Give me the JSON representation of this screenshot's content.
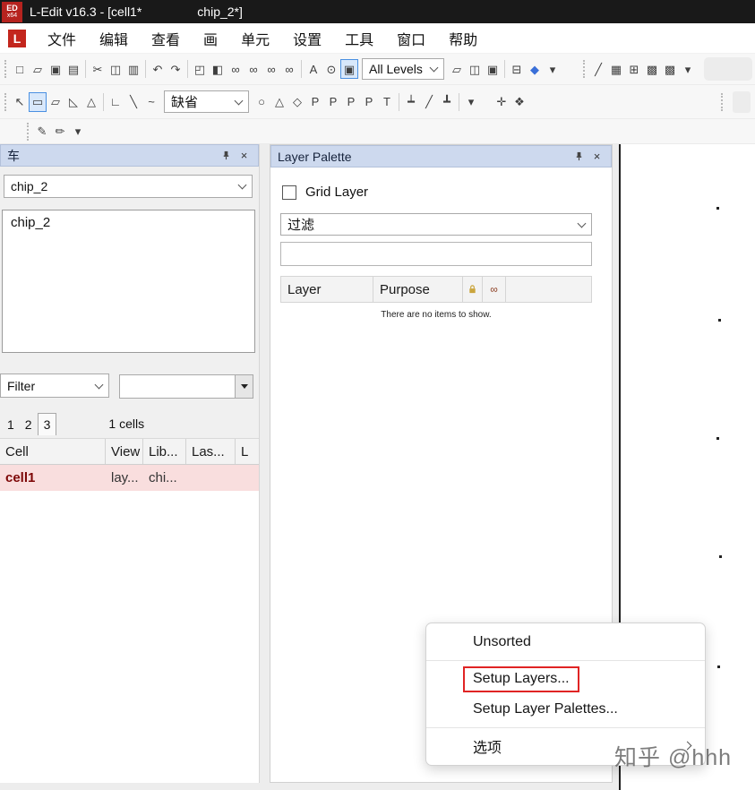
{
  "window": {
    "app_badge": "ED",
    "app_badge_sub": "x64",
    "title": "L-Edit v16.3 - [cell1*",
    "tab_title": "chip_2*]"
  },
  "menu": {
    "logo": "L",
    "items": [
      {
        "n": "menu-file",
        "label": "文件"
      },
      {
        "n": "menu-edit",
        "label": "编辑"
      },
      {
        "n": "menu-view",
        "label": "查看"
      },
      {
        "n": "menu-draw",
        "label": "画"
      },
      {
        "n": "menu-cell",
        "label": "单元"
      },
      {
        "n": "menu-setup",
        "label": "设置"
      },
      {
        "n": "menu-tools",
        "label": "工具"
      },
      {
        "n": "menu-window",
        "label": "窗口"
      },
      {
        "n": "menu-help",
        "label": "帮助"
      }
    ]
  },
  "toolbar_standard": {
    "items": [
      {
        "n": "new-file-icon",
        "g": "□"
      },
      {
        "n": "open-file-icon",
        "g": "▱"
      },
      {
        "n": "import-file-icon",
        "g": "▣"
      },
      {
        "n": "print-icon",
        "g": "▤"
      },
      {
        "sep": true
      },
      {
        "n": "cut-icon",
        "g": "✂"
      },
      {
        "n": "copy-icon",
        "g": "◫"
      },
      {
        "n": "paste-icon",
        "g": "▥"
      },
      {
        "sep": true
      },
      {
        "n": "undo-icon",
        "g": "↶"
      },
      {
        "n": "redo-icon",
        "g": "↷"
      },
      {
        "sep": true
      },
      {
        "n": "design-navigator-icon",
        "g": "◰"
      },
      {
        "n": "library-browser-icon",
        "g": "◧"
      },
      {
        "n": "find-icon",
        "g": "∞"
      },
      {
        "n": "find-next-icon",
        "g": "∞"
      },
      {
        "n": "find-previous-icon",
        "g": "∞"
      },
      {
        "n": "find-object-icon",
        "g": "∞"
      },
      {
        "sep": true
      },
      {
        "n": "zoom-text-icon",
        "g": "A"
      },
      {
        "n": "zoom-tool-icon",
        "g": "⊙"
      },
      {
        "n": "view-levels-icon",
        "g": "▣",
        "active": true
      }
    ],
    "levels_combo": "All Levels",
    "items_right": [
      {
        "n": "open-cell-icon",
        "g": "▱"
      },
      {
        "n": "paste-to-cell-icon",
        "g": "◫"
      },
      {
        "n": "edit-in-place-icon",
        "g": "▣"
      },
      {
        "sep": true
      },
      {
        "n": "cross-section-icon",
        "g": "⊟"
      },
      {
        "n": "highlight-icon",
        "g": "◆",
        "c": "#3a6fd8"
      },
      {
        "n": "toolbar-options-icon",
        "g": "▾"
      }
    ],
    "items_far": [
      {
        "n": "draw-line-icon",
        "g": "╱"
      },
      {
        "n": "save-view-icon",
        "g": "▦"
      },
      {
        "n": "design-rule-icon",
        "g": "⊞"
      },
      {
        "n": "window-tile-icon",
        "g": "▩"
      },
      {
        "n": "window-cascade-icon",
        "g": "▩"
      },
      {
        "n": "overflow-icon",
        "g": "▾"
      }
    ]
  },
  "toolbar_draw": {
    "items": [
      {
        "n": "select-cursor-icon",
        "g": "↖"
      },
      {
        "n": "rectangle-tool-icon",
        "g": "▭",
        "active": true
      },
      {
        "n": "polygon-90-tool-icon",
        "g": "▱"
      },
      {
        "n": "polygon-45-tool-icon",
        "g": "◺"
      },
      {
        "n": "polygon-any-angle-tool-icon",
        "g": "△"
      },
      {
        "sep": true
      },
      {
        "n": "wire-90-tool-icon",
        "g": "∟"
      },
      {
        "n": "wire-45-tool-icon",
        "g": "╲"
      },
      {
        "n": "wire-any-angle-tool-icon",
        "g": "~"
      }
    ],
    "style_combo": "缺省",
    "items_right": [
      {
        "n": "circle-tool-icon",
        "g": "○"
      },
      {
        "n": "pie-tool-icon",
        "g": "△"
      },
      {
        "n": "torus-tool-icon",
        "g": "◇"
      },
      {
        "n": "port-box-tool-icon",
        "g": "P"
      },
      {
        "n": "port-point-tool-icon",
        "g": "P"
      },
      {
        "n": "port-line-tool-icon",
        "g": "P"
      },
      {
        "n": "port-polygon-tool-icon",
        "g": "P"
      },
      {
        "n": "text-tool-icon",
        "g": "T"
      },
      {
        "sep": true
      },
      {
        "n": "ruler-90-tool-icon",
        "g": "┷"
      },
      {
        "n": "ruler-45-tool-icon",
        "g": "╱"
      },
      {
        "n": "ruler-any-tool-icon",
        "g": "┻"
      },
      {
        "sep": true
      },
      {
        "n": "toolbar-options-icon",
        "g": "▾"
      }
    ],
    "items_far": [
      {
        "n": "move-point-icon",
        "g": "✛"
      },
      {
        "n": "rotate-tool-icon",
        "g": "❖"
      }
    ]
  },
  "toolbar_small": {
    "items": [
      {
        "n": "pen-tool-icon",
        "g": "✎"
      },
      {
        "n": "marker-tool-icon",
        "g": "✏"
      },
      {
        "n": "toolbar-options-icon",
        "g": "▾"
      }
    ]
  },
  "left_panel": {
    "title": "车",
    "cell_combo": "chip_2",
    "list_items": [
      "chip_2"
    ],
    "filter_combo": "Filter",
    "tabs": [
      "1",
      "2",
      "3"
    ],
    "count_label": "1 cells",
    "table": {
      "headers": [
        "Cell",
        "View",
        "Lib...",
        "Las...",
        "L"
      ],
      "row": [
        "cell1",
        "lay...",
        "chi..."
      ]
    }
  },
  "layer_palette": {
    "title": "Layer Palette",
    "grid_layer_label": "Grid Layer",
    "filter_combo": "过滤",
    "search_value": "",
    "table_headers": [
      "Layer",
      "Purpose"
    ],
    "empty_message": "There are no items to show."
  },
  "context_menu": {
    "items": [
      {
        "n": "context-item-unsorted",
        "label": "Unsorted"
      },
      {
        "sep": true
      },
      {
        "n": "context-item-setup-layers",
        "label": "Setup Layers...",
        "boxed": true
      },
      {
        "n": "context-item-setup-layer-palettes",
        "label": "Setup Layer Palettes..."
      },
      {
        "sep": true
      },
      {
        "n": "context-item-options",
        "label": "选项",
        "submenu": true
      }
    ]
  },
  "icons": {
    "close": "×",
    "eye": "∞"
  },
  "colors": {
    "titlebar": "#191919",
    "panel_header": "#cdd9ee",
    "accent_blue": "#4a90e2",
    "row_highlight_bg": "#f9dede",
    "row_highlight_text": "#7d0606",
    "annotation_red": "#e02424"
  },
  "watermark": "知乎 @hhh"
}
